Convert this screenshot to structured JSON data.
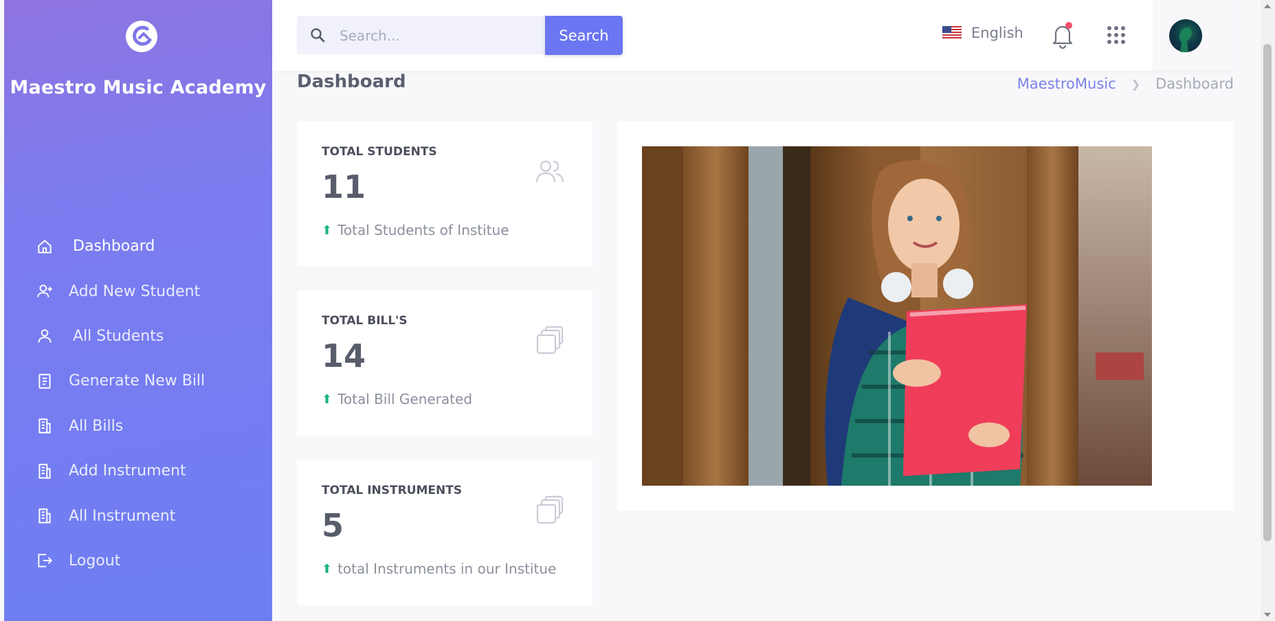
{
  "sidebar": {
    "brand": "Maestro Music Academy",
    "items": [
      {
        "label": "Dashboard",
        "icon": "home-icon",
        "active": true
      },
      {
        "label": "Add New Student",
        "icon": "user-plus-icon"
      },
      {
        "label": "All Students",
        "icon": "user-icon"
      },
      {
        "label": "Generate New Bill",
        "icon": "document-icon"
      },
      {
        "label": "All Bills",
        "icon": "bills-icon"
      },
      {
        "label": "Add Instrument",
        "icon": "bills-icon"
      },
      {
        "label": "All Instrument",
        "icon": "bills-icon"
      },
      {
        "label": "Logout",
        "icon": "logout-icon"
      }
    ]
  },
  "header": {
    "search_placeholder": "Search...",
    "search_button": "Search",
    "language": "English"
  },
  "page": {
    "title": "Dashboard",
    "breadcrumb": [
      "MaestroMusic",
      "Dashboard"
    ]
  },
  "cards": [
    {
      "label": "TOTAL STUDENTS",
      "value": "11",
      "desc": "Total Students of Institue",
      "icon": "users-icon"
    },
    {
      "label": "TOTAL BILL'S",
      "value": "14",
      "desc": "Total Bill Generated",
      "icon": "stack-icon"
    },
    {
      "label": "TOTAL INSTRUMENTS",
      "value": "5",
      "desc": "total Instruments in our Institue",
      "icon": "stack-icon"
    }
  ],
  "colors": {
    "accent": "#6a76f2",
    "sidebar_top": "#8e74e0",
    "sidebar_bottom": "#6d7ef2",
    "trend_up": "#1bb57a",
    "notification_dot": "#f0506e"
  }
}
